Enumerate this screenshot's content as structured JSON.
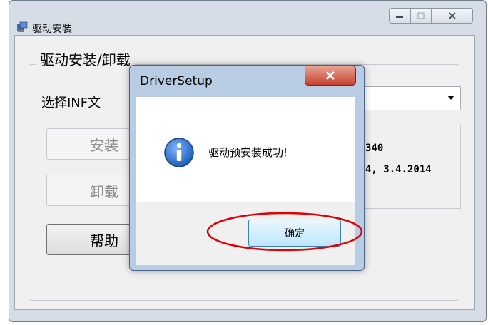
{
  "window": {
    "title": "驱动安装",
    "controls": {
      "minimize_icon": "minimize-icon",
      "maximize_icon": "maximize-icon",
      "close_icon": "close-icon"
    }
  },
  "main": {
    "group_title": "驱动安装/卸载",
    "select_label": "选择INF文",
    "info_lines": [
      "340",
      "4, 3.4.2014"
    ],
    "buttons": {
      "install": "安装",
      "uninstall": "卸载",
      "help": "帮助"
    }
  },
  "dialog": {
    "title": "DriverSetup",
    "close_label": "x",
    "message": "驱动预安装成功!",
    "ok_label": "确定"
  },
  "colors": {
    "annotation": "#e00000",
    "info_icon": "#1f5fb8"
  }
}
